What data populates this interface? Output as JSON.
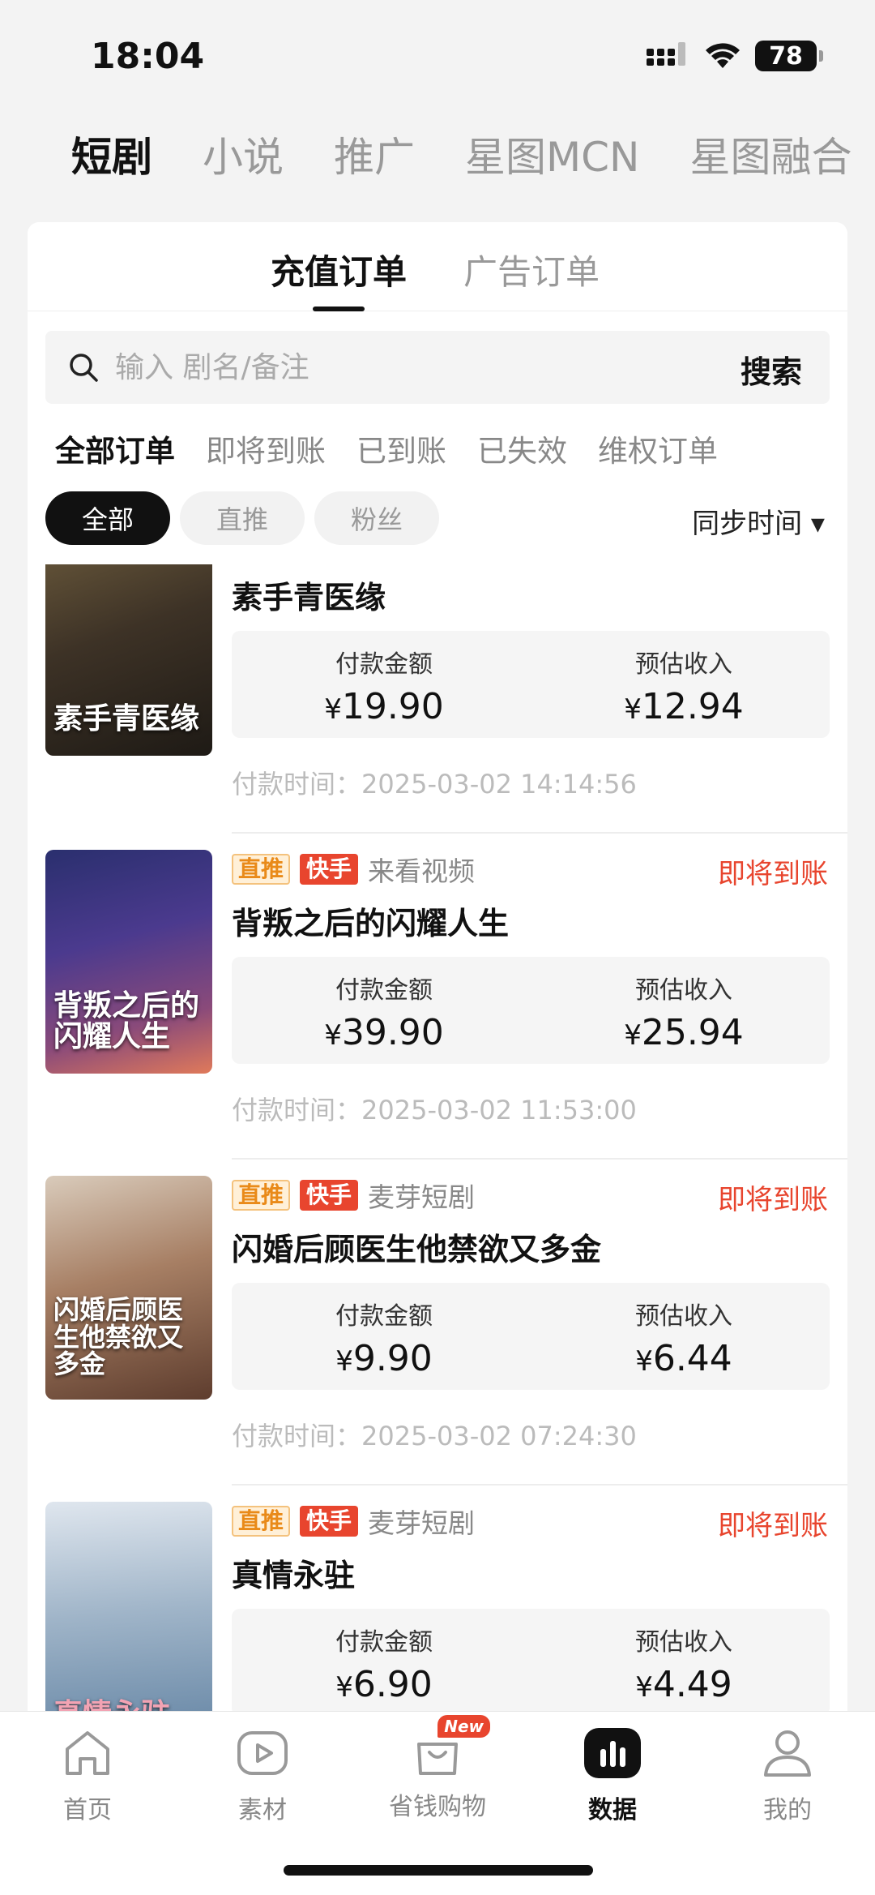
{
  "status_bar": {
    "time": "18:04",
    "battery": "78"
  },
  "top_tabs": [
    {
      "label": "短剧",
      "active": true
    },
    {
      "label": "小说",
      "active": false
    },
    {
      "label": "推广",
      "active": false
    },
    {
      "label": "星图MCN",
      "active": false
    },
    {
      "label": "星图融合",
      "active": false
    }
  ],
  "order_tabs": {
    "recharge": "充值订单",
    "ad": "广告订单"
  },
  "search": {
    "placeholder": "输入 剧名/备注",
    "button": "搜索"
  },
  "status_filter": [
    "全部订单",
    "即将到账",
    "已到账",
    "已失效",
    "维权订单"
  ],
  "chips": [
    "全部",
    "直推",
    "粉丝"
  ],
  "sort_label": "同步时间 ▾",
  "amount_labels": {
    "paid": "付款金额",
    "income": "预估收入"
  },
  "orders": [
    {
      "title": "素手青医缘",
      "poster_text": "素手青医缘",
      "paid": "19.90",
      "income": "12.94",
      "pay_time": "付款时间：2025-03-02 14:14:56"
    },
    {
      "tag": "直推",
      "platform": "快手",
      "source": "来看视频",
      "status": "即将到账",
      "title": "背叛之后的闪耀人生",
      "poster_text": "背叛之后的闪耀人生",
      "paid": "39.90",
      "income": "25.94",
      "pay_time": "付款时间：2025-03-02 11:53:00"
    },
    {
      "tag": "直推",
      "platform": "快手",
      "source": "麦芽短剧",
      "status": "即将到账",
      "title": "闪婚后顾医生他禁欲又多金",
      "poster_text": "闪婚后顾医生他禁欲又多金",
      "paid": "9.90",
      "income": "6.44",
      "pay_time": "付款时间：2025-03-02 07:24:30"
    },
    {
      "tag": "直推",
      "platform": "快手",
      "source": "麦芽短剧",
      "status": "即将到账",
      "title": "真情永驻",
      "poster_text": "真情永驻",
      "paid": "6.90",
      "income": "4.49"
    }
  ],
  "currency": "¥",
  "bottom_nav": [
    {
      "label": "首页",
      "icon": "home-icon"
    },
    {
      "label": "素材",
      "icon": "play-icon"
    },
    {
      "label": "省钱购物",
      "icon": "shopping-bag-icon",
      "badge": "New"
    },
    {
      "label": "数据",
      "icon": "bar-chart-icon",
      "active": true
    },
    {
      "label": "我的",
      "icon": "user-icon"
    }
  ]
}
